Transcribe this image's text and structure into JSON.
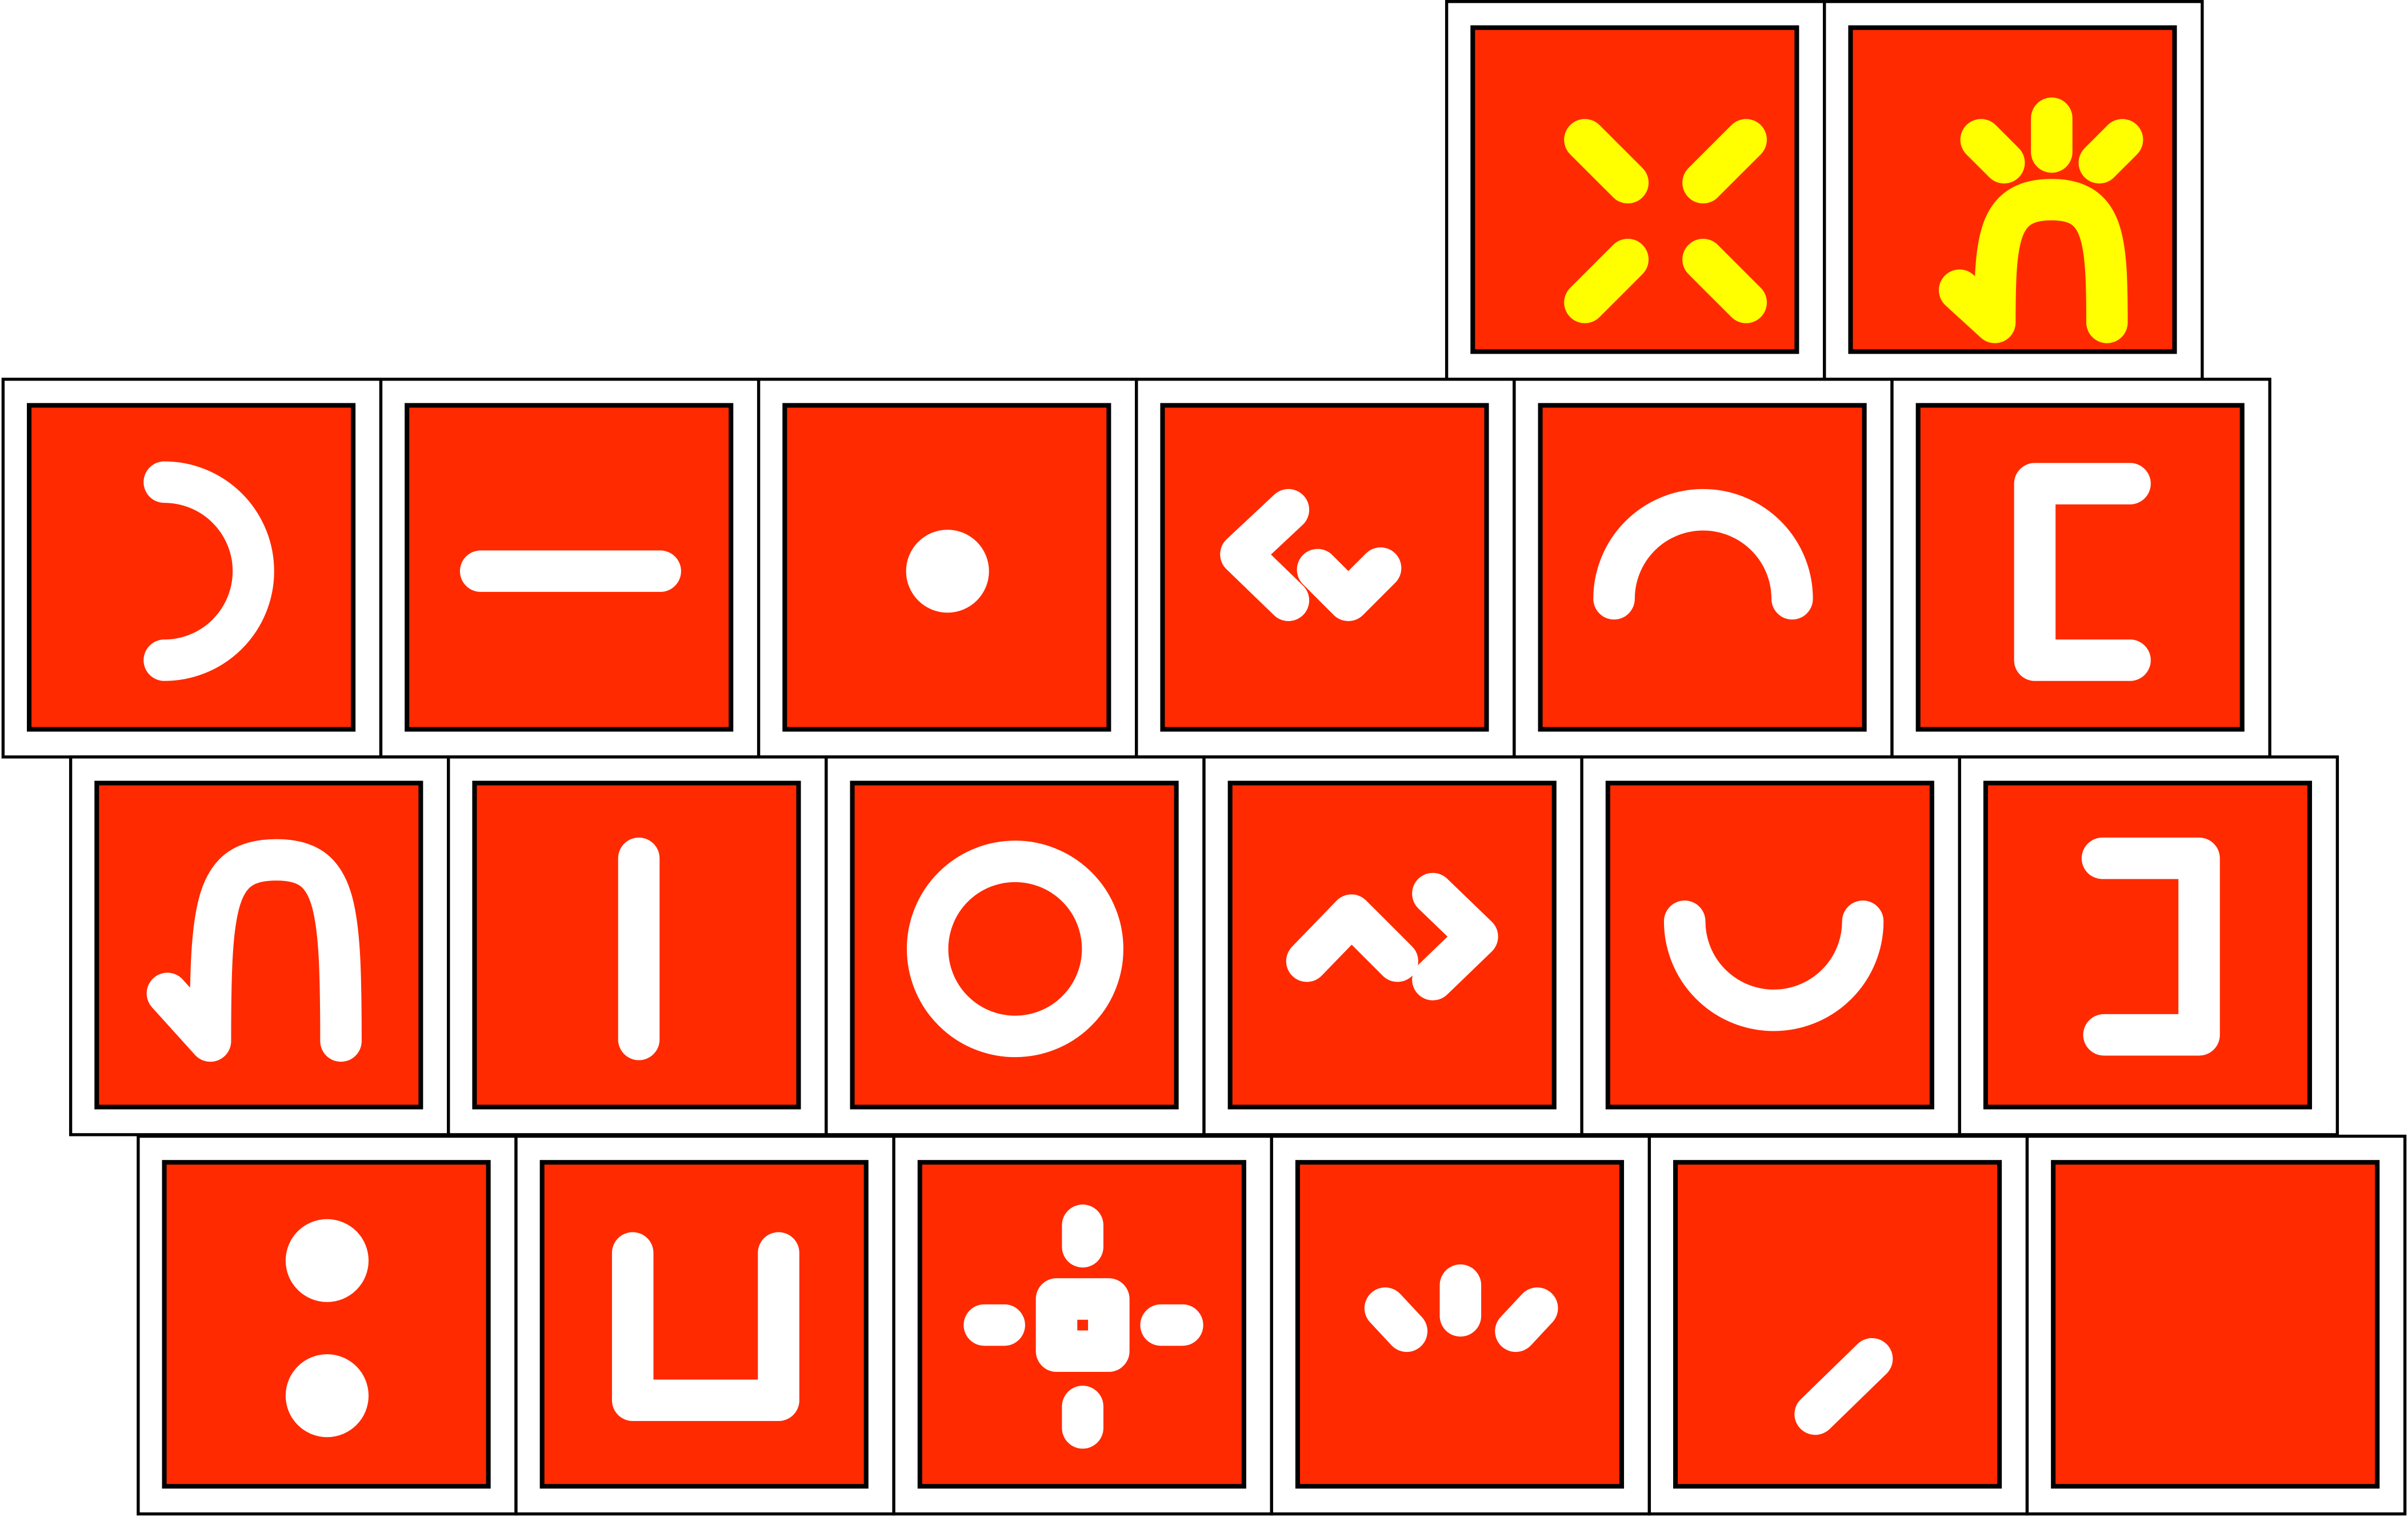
{
  "colors": {
    "background": "#ffffff",
    "tile_fill": "#ff2a00",
    "tile_border": "#000000",
    "glyph_default": "#ffffff",
    "glyph_highlight": "#ffff00"
  },
  "keyboard": {
    "rows": [
      {
        "keys": [
          {
            "glyph": "burst-icon",
            "glyph_color": "highlight"
          },
          {
            "glyph": "hook-arch-rays-icon",
            "glyph_color": "highlight"
          }
        ]
      },
      {
        "keys": [
          {
            "glyph": "right-half-circle-icon",
            "glyph_color": "default"
          },
          {
            "glyph": "horizontal-bar-icon",
            "glyph_color": "default"
          },
          {
            "glyph": "dot-icon",
            "glyph_color": "default"
          },
          {
            "glyph": "left-angle-down-angle-icon",
            "glyph_color": "default"
          },
          {
            "glyph": "top-arc-icon",
            "glyph_color": "default"
          },
          {
            "glyph": "left-bracket-icon",
            "glyph_color": "default"
          }
        ]
      },
      {
        "keys": [
          {
            "glyph": "hook-arch-icon",
            "glyph_color": "default"
          },
          {
            "glyph": "vertical-bar-icon",
            "glyph_color": "default"
          },
          {
            "glyph": "ring-icon",
            "glyph_color": "default"
          },
          {
            "glyph": "up-angle-right-angle-icon",
            "glyph_color": "default"
          },
          {
            "glyph": "bottom-arc-icon",
            "glyph_color": "default"
          },
          {
            "glyph": "right-bracket-icon",
            "glyph_color": "default"
          }
        ]
      },
      {
        "keys": [
          {
            "glyph": "two-dots-icon",
            "glyph_color": "default"
          },
          {
            "glyph": "cup-icon",
            "glyph_color": "default"
          },
          {
            "glyph": "target-cross-icon",
            "glyph_color": "default"
          },
          {
            "glyph": "three-ticks-icon",
            "glyph_color": "default"
          },
          {
            "glyph": "slash-icon",
            "glyph_color": "default"
          },
          {
            "glyph": "blank-icon",
            "glyph_color": "default"
          }
        ]
      }
    ]
  }
}
